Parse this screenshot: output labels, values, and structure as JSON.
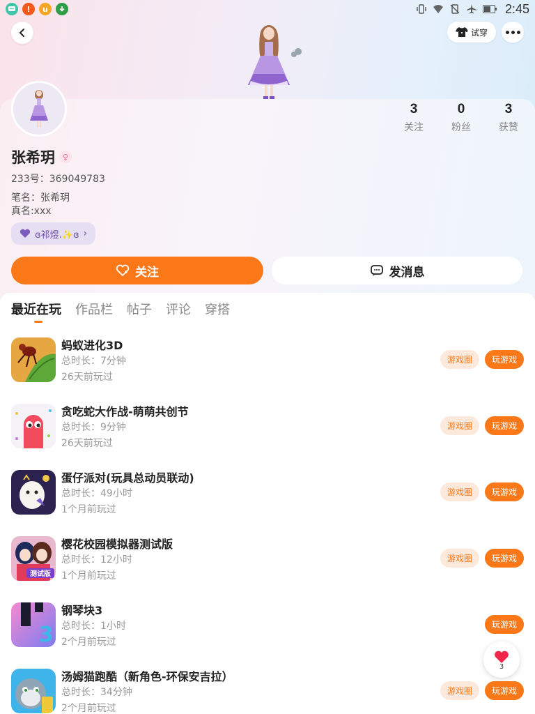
{
  "status_bar": {
    "time": "2:45",
    "notification_icons": [
      "chat-bubble-icon",
      "alert-icon",
      "u-app-icon",
      "download-icon"
    ],
    "system_icons": [
      "vibrate-icon",
      "wifi-icon",
      "no-sim-icon",
      "airplane-icon",
      "battery-icon"
    ]
  },
  "header": {
    "tryon_label": "试穿"
  },
  "profile": {
    "name": "张希玥",
    "uid": "233号：369049783",
    "pen_name": "笔名：张希玥",
    "real_name": "真名:xxx",
    "cp_tag": "ɞ祁煜.✨ɞ",
    "stats": [
      {
        "value": "3",
        "label": "关注"
      },
      {
        "value": "0",
        "label": "粉丝"
      },
      {
        "value": "3",
        "label": "获赞"
      }
    ]
  },
  "actions": {
    "follow_label": "关注",
    "message_label": "发消息"
  },
  "tabs": [
    {
      "label": "最近在玩",
      "active": true
    },
    {
      "label": "作品栏",
      "active": false
    },
    {
      "label": "帖子",
      "active": false
    },
    {
      "label": "评论",
      "active": false
    },
    {
      "label": "穿搭",
      "active": false
    }
  ],
  "games": [
    {
      "title": "蚂蚁进化3D",
      "duration": "总时长：7分钟",
      "last_played": "26天前玩过",
      "circle_label": "游戏圈",
      "play_label": "玩游戏",
      "has_circle": true
    },
    {
      "title": "贪吃蛇大作战-萌萌共创节",
      "duration": "总时长：9分钟",
      "last_played": "26天前玩过",
      "circle_label": "游戏圈",
      "play_label": "玩游戏",
      "has_circle": true
    },
    {
      "title": "蛋仔派对(玩具总动员联动)",
      "duration": "总时长：49小时",
      "last_played": "1个月前玩过",
      "circle_label": "游戏圈",
      "play_label": "玩游戏",
      "has_circle": true
    },
    {
      "title": "樱花校园模拟器测试版",
      "duration": "总时长：12小时",
      "last_played": "1个月前玩过",
      "circle_label": "游戏圈",
      "play_label": "玩游戏",
      "has_circle": true,
      "icon_text": "测试版"
    },
    {
      "title": "钢琴块3",
      "duration": "总时长：1小时",
      "last_played": "2个月前玩过",
      "play_label": "玩游戏",
      "has_circle": false,
      "icon_text": "3"
    },
    {
      "title": "汤姆猫跑酷（新角色-环保安吉拉）",
      "duration": "总时长：34分钟",
      "last_played": "2个月前玩过",
      "circle_label": "游戏圈",
      "play_label": "玩游戏",
      "has_circle": true
    }
  ],
  "like_fab": {
    "count": "3"
  },
  "colors": {
    "accent": "#fb7818",
    "accent_light": "#fde9dc",
    "text_primary": "#222222",
    "text_secondary": "#999999"
  }
}
